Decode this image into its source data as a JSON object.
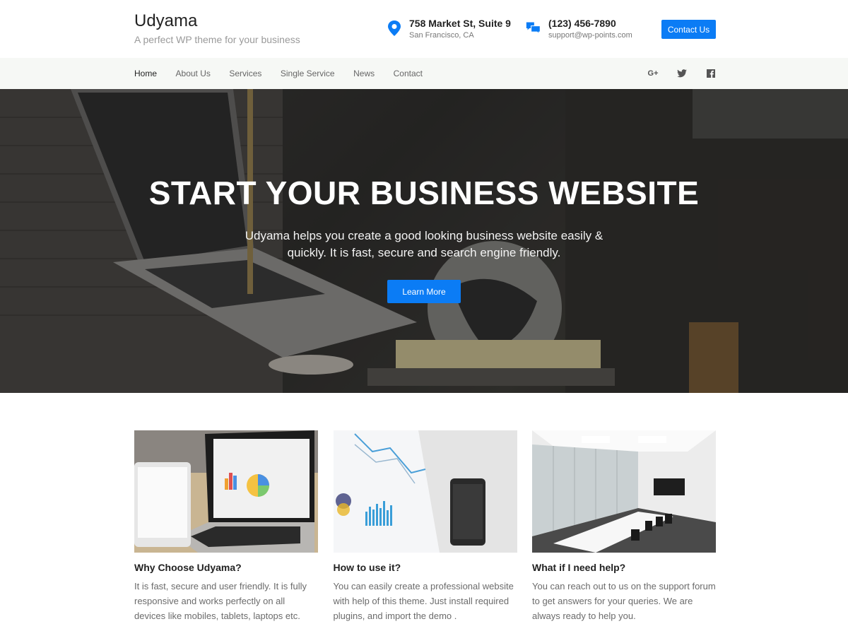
{
  "header": {
    "brand_name": "Udyama",
    "tagline": "A perfect WP theme for your business",
    "address": {
      "line1": "758 Market St, Suite 9",
      "line2": "San Francisco, CA",
      "icon": "map-pin-icon"
    },
    "phone": {
      "line1": "(123) 456-7890",
      "line2": "support@wp-points.com",
      "icon": "chat-bubbles-icon"
    },
    "contact_button": "Contact Us",
    "accent_color": "#0b7cf5"
  },
  "nav": {
    "items": [
      {
        "label": "Home",
        "active": true
      },
      {
        "label": "About Us"
      },
      {
        "label": "Services"
      },
      {
        "label": "Single Service"
      },
      {
        "label": "News"
      },
      {
        "label": "Contact"
      }
    ],
    "social": [
      {
        "icon": "google-plus-icon",
        "glyph": "G+"
      },
      {
        "icon": "twitter-icon"
      },
      {
        "icon": "facebook-icon"
      }
    ]
  },
  "hero": {
    "title": "START YOUR BUSINESS WEBSITE",
    "subtitle": "Udyama helps you create a good looking business website easily & quickly. It is fast, secure and search engine friendly.",
    "button": "Learn More"
  },
  "cards": [
    {
      "title": "Why Choose Udyama?",
      "text": "It is fast, secure and user friendly. It is fully responsive and works perfectly on all devices like mobiles, tablets, laptops etc."
    },
    {
      "title": "How to use it?",
      "text": "You can easily create a professional website with help of this theme. Just install required plugins, and import the demo ."
    },
    {
      "title": "What if I need help?",
      "text": "You can reach out to us on the support forum to get answers for your queries. We are always ready to help you."
    }
  ]
}
